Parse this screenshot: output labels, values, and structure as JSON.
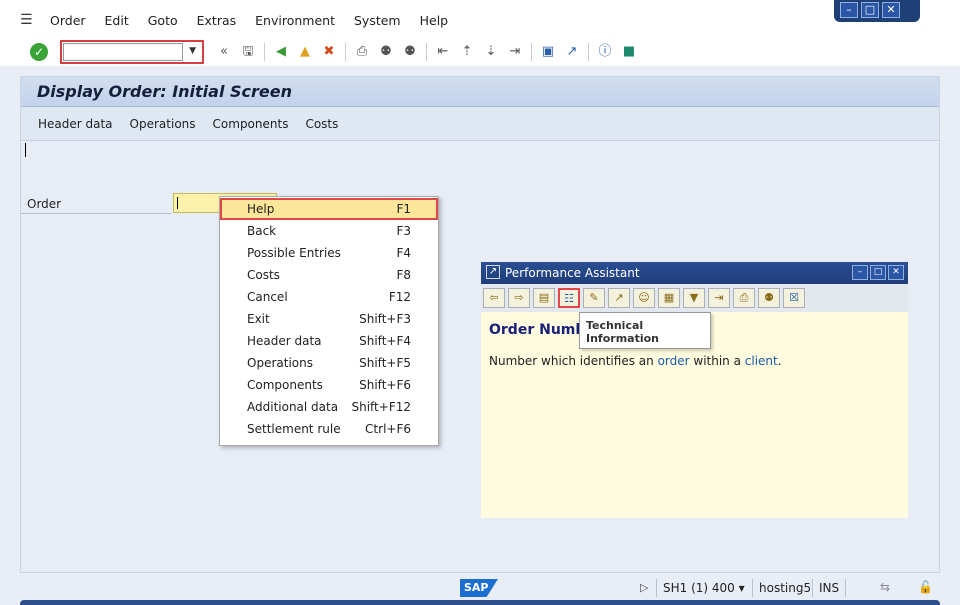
{
  "menu": {
    "items": [
      "Order",
      "Edit",
      "Goto",
      "Extras",
      "Environment",
      "System",
      "Help"
    ]
  },
  "toolbar": {
    "command_value": "",
    "back_glyph": "«"
  },
  "screen": {
    "title": "Display Order: Initial Screen",
    "app_toolbar": [
      "Header data",
      "Operations",
      "Components",
      "Costs"
    ],
    "order_label": "Order",
    "order_value": ""
  },
  "context_menu": {
    "items": [
      {
        "label": "Help",
        "key": "F1"
      },
      {
        "label": "Back",
        "key": "F3"
      },
      {
        "label": "Possible Entries",
        "key": "F4"
      },
      {
        "label": "Costs",
        "key": "F8"
      },
      {
        "label": "Cancel",
        "key": "F12"
      },
      {
        "label": "Exit",
        "key": "Shift+F3"
      },
      {
        "label": "Header data",
        "key": "Shift+F4"
      },
      {
        "label": "Operations",
        "key": "Shift+F5"
      },
      {
        "label": "Components",
        "key": "Shift+F6"
      },
      {
        "label": "Additional data",
        "key": "Shift+F12"
      },
      {
        "label": "Settlement rule",
        "key": "Ctrl+F6"
      }
    ]
  },
  "performance_assistant": {
    "title": "Performance Assistant",
    "heading": "Order Number",
    "text_before": "Number which identifies an ",
    "link1": "order",
    "text_middle": " within a ",
    "link2": "client",
    "text_after": ".",
    "tooltip": "Technical Information"
  },
  "status": {
    "logo": "SAP",
    "system": "SH1 (1) 400",
    "host": "hosting5",
    "mode": "INS"
  }
}
